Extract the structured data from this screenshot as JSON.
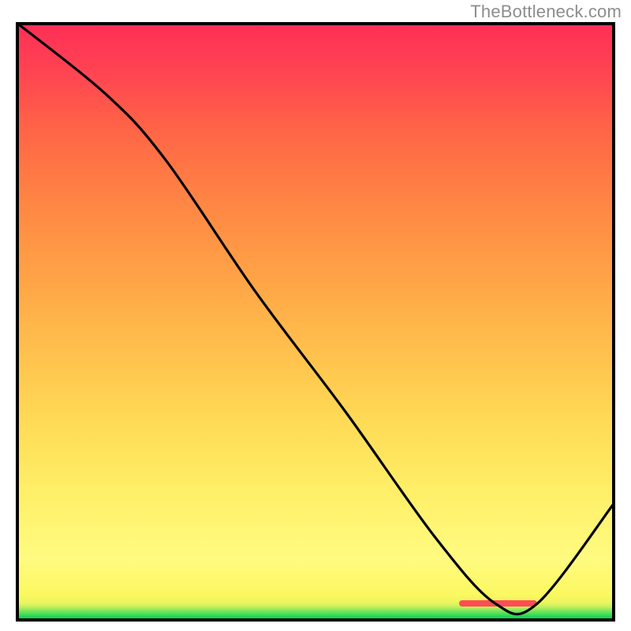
{
  "attribution": "TheBottleneck.com",
  "colors": {
    "border": "#000000",
    "curve": "#000000",
    "marker": "#ff4d55",
    "attribution_text": "#8d8d8d"
  },
  "chart_data": {
    "type": "line",
    "title": "",
    "xlabel": "",
    "ylabel": "",
    "xlim": [
      0,
      100
    ],
    "ylim": [
      0,
      100
    ],
    "grid": false,
    "background_gradient": "green-to-red (vertical, bottom=green top=red)",
    "series": [
      {
        "name": "bottleneck-curve",
        "x": [
          0,
          15,
          25,
          40,
          55,
          70,
          80,
          87,
          100
        ],
        "y": [
          100,
          88,
          77,
          55,
          35,
          14,
          3,
          3,
          20
        ]
      }
    ],
    "annotations": [
      {
        "name": "optimal-range-marker",
        "type": "hspan",
        "x_start": 74,
        "x_end": 87,
        "y": 3,
        "color": "#ff4d55"
      }
    ]
  }
}
